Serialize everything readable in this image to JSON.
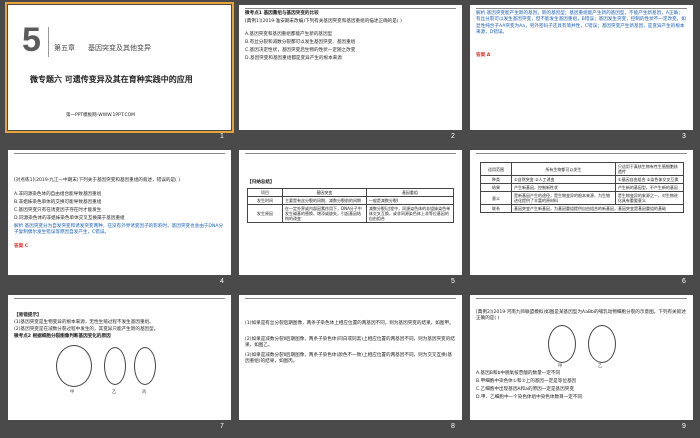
{
  "slides": [
    {
      "number": "1",
      "big_digit": "5",
      "chapter": "第五章",
      "chapter_title": "基因突变及其他变异",
      "title": "微专题六  可遗传变异及其在育种实践中的应用",
      "footer": "第一PPT模板网-WWW.1PPT.COM"
    },
    {
      "number": "2",
      "lines": [
        "微考点1  基因重组与基因突变的比较",
        "[典例1](2019·淮安期末改编)下列有关基因突变和基因重组的描述正确的是(     )",
        "A.基因突变和基因重组都能产生新的基因型",
        "B.有丝分裂和减数分裂都可以发生基因突变、基因重组",
        "C.基因决定性状，基因突变后生物的性状一定随之改变",
        "D.基因突变和基因重组都是变异产生的根本来源"
      ]
    },
    {
      "number": "3",
      "lines": [
        "解析  基因突变能产生新的基因，新的基因型；基因重组能产生新的基因型，不能产生新基因，A正确；有丝分裂可以发生基因突变，但不能发生基因重组，B错误；基因发生突变，控制的性状不一定改变，如显性纯合子AA突变为Aa，另外密码子还具有简并性，C错误；基因突变产生新基因，是变异产生的根本来源，D错误。",
        "答案  A"
      ]
    },
    {
      "number": "4",
      "lines": [
        "[对点练1](2019·九江一中期末)下列关于基因突变和基因重组的叙述，错误的是(        )",
        "A.非同源染色体的自由组合能导致基因重组",
        "B.非姐妹染色单体的交换可能导致基因重组",
        "C.基因突变只有在诱变因子存在时才能发生",
        "D.同源染色体的非姐妹染色单体交叉互换属于基因重组",
        "解析  基因突变分为自发突变和诱发突变两种，在没有外界诱变因子的影响时，基因突变也会由于DNA分子复制偶尔发生错误等原因自发产生，C错误。",
        "答案  C"
      ]
    },
    {
      "number": "5",
      "header": "【归纳总结】",
      "table": [
        [
          "项目",
          "基因突变",
          "基因重组"
        ],
        [
          "发生时间",
          "主要是有丝分裂的间期、减数分裂前的间期",
          "一般是减数分裂Ⅰ"
        ],
        [
          "发生原因",
          "在一定外界或内部因素作用下，DNA分子中发生碱基的替换、增添或缺失，引起基因结构的改变",
          "减数分裂Ⅰ过程中，同源染色体的非姐妹染色单体交叉互换，或非同源染色体上非等位基因的自由组合"
        ]
      ]
    },
    {
      "number": "6",
      "table": [
        [
          "适用范围",
          "所有生物都可以发生",
          "只适用于真核生物有性生殖细胞核遗传"
        ],
        [
          "种类",
          "①自然突变  ②人工诱变",
          "①基因自由组合  ②染色体交叉互换"
        ],
        [
          "结果",
          "产生新基因，控制新性状",
          "产生新的基因型，不产生新的基因"
        ],
        [
          "意义",
          "是新基因产生的途径，是生物变异的根本来源，为生物进化提供了丰富的原材料",
          "是生物变异的来源之一，对生物进化具有重要意义"
        ],
        [
          "联系",
          "基因突变产生新基因，为基因重组提供自由组合的新基因，基因突变是基因重组的基础",
          ""
        ]
      ]
    },
    {
      "number": "7",
      "lines": [
        "【易错提示】",
        "(1)基因突变是生物变异的根本来源，无性生殖过程不发生基因重组。",
        "(2)基因突变是在减数分裂过程中发生的，其变异只能产生新的基因型。",
        "微考点2  根据细胞分裂图像判断基因变化的原因"
      ],
      "figure_labels": [
        "甲",
        "乙",
        "丙"
      ]
    },
    {
      "number": "8",
      "lines": [
        "(1)如果是有丝分裂后期图像，两条子染色体上相应位置的两基因不同，则为基因突变的结果，如图甲。",
        "(2)如果是减数分裂Ⅱ后期图像，两条子染色体(同白或同黑)上相应位置的两基因不同，则为基因突变的结果，如图乙。",
        "(3)如果是减数分裂Ⅱ后期图像，两条子染色体(颜色不一致)上相应位置的两基因不同，则为交叉互换(基因重组)的结果，如图丙。"
      ]
    },
    {
      "number": "9",
      "lines": [
        "[典例2](2019·河南九师联盟模拟)如图是某基因型为AaBb的哺乳动物细胞分裂的示意图。下列有关叙述正确的是(     )",
        "A.基因B和b中脱氧核苷酸的数量一定不同",
        "B.甲细胞中染色体①和②上的基因一定是等位基因",
        "C.乙细胞中出现基因A和a的原因一定是基因突变",
        "D.甲、乙细胞中一个染色体组中染色体数目一定不同"
      ],
      "figure_labels": [
        "甲",
        "乙"
      ]
    }
  ],
  "colors": {
    "accent_blue": "#1a5fb4",
    "answer_red": "#d9322b",
    "selection": "#e8a33a"
  }
}
